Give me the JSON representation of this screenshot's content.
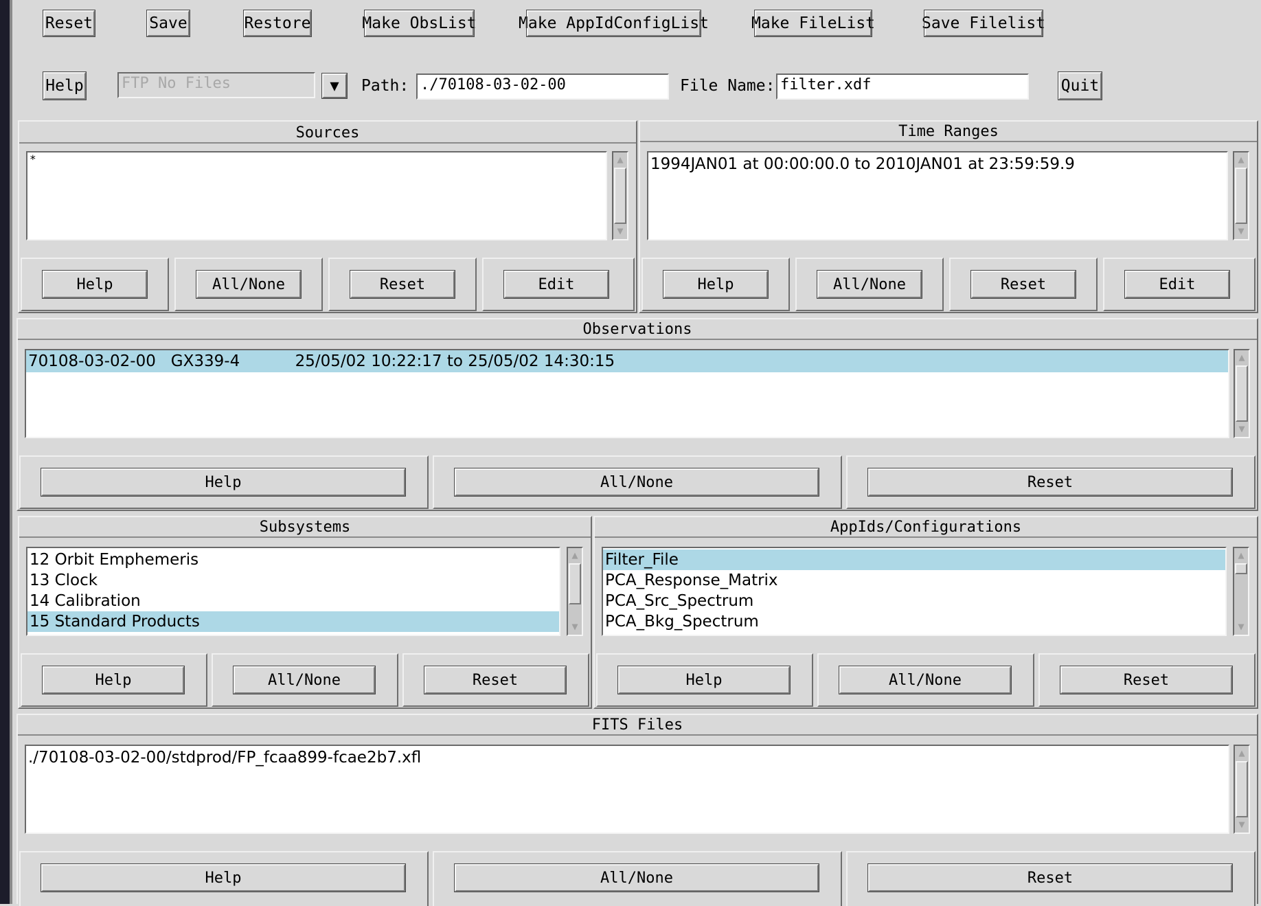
{
  "toolbar": {
    "reset": "Reset",
    "save": "Save",
    "restore": "Restore",
    "make_obslist": "Make ObsList",
    "make_appidconfiglist": "Make AppIdConfigList",
    "make_filelist": "Make FileList",
    "save_filelist": "Save Filelist"
  },
  "pathbar": {
    "help": "Help",
    "ftp_value": "FTP No Files",
    "path_label": "Path:",
    "path_value": "./70108-03-02-00",
    "filename_label": "File Name:",
    "filename_value": "filter.xdf",
    "quit": "Quit"
  },
  "sources": {
    "title": "Sources",
    "items": [
      "*"
    ],
    "buttons": {
      "help": "Help",
      "allnone": "All/None",
      "reset": "Reset",
      "edit": "Edit"
    }
  },
  "time_ranges": {
    "title": "Time Ranges",
    "items": [
      "1994JAN01 at 00:00:00.0 to 2010JAN01 at 23:59:59.9"
    ],
    "buttons": {
      "help": "Help",
      "allnone": "All/None",
      "reset": "Reset",
      "edit": "Edit"
    }
  },
  "observations": {
    "title": "Observations",
    "items": [
      "70108-03-02-00   GX339-4           25/05/02 10:22:17 to 25/05/02 14:30:15"
    ],
    "buttons": {
      "help": "Help",
      "allnone": "All/None",
      "reset": "Reset"
    }
  },
  "subsystems": {
    "title": "Subsystems",
    "items": [
      "12 Orbit Emphemeris",
      "13 Clock",
      "14 Calibration",
      "15 Standard Products"
    ],
    "selected_index": 3,
    "buttons": {
      "help": "Help",
      "allnone": "All/None",
      "reset": "Reset"
    }
  },
  "appids": {
    "title": "AppIds/Configurations",
    "items": [
      "Filter_File",
      "PCA_Response_Matrix",
      "PCA_Src_Spectrum",
      "PCA_Bkg_Spectrum"
    ],
    "selected_index": 0,
    "buttons": {
      "help": "Help",
      "allnone": "All/None",
      "reset": "Reset"
    }
  },
  "fits_files": {
    "title": "FITS Files",
    "items": [
      "./70108-03-02-00/stdprod/FP_fcaa899-fcae2b7.xfl"
    ],
    "buttons": {
      "help": "Help",
      "allnone": "All/None",
      "reset": "Reset"
    }
  },
  "icons": {
    "dropdown": "dropdown-arrow-icon",
    "scroll_up": "scroll-up-arrow-icon",
    "scroll_down": "scroll-down-arrow-icon"
  },
  "colors": {
    "background": "#d9d9d9",
    "selection": "#add8e6",
    "list_bg": "#ffffff"
  }
}
